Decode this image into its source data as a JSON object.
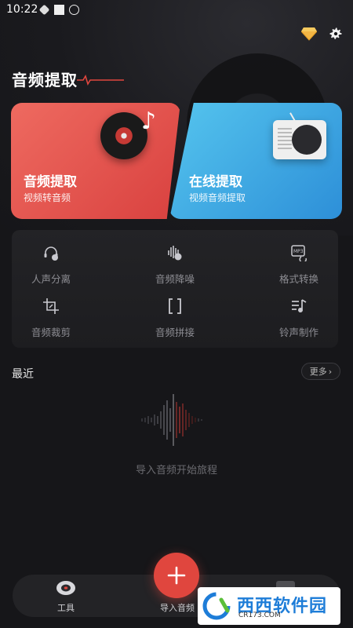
{
  "status_bar": {
    "time": "10:22"
  },
  "header": {
    "title": "音频提取"
  },
  "cards": [
    {
      "title": "音频提取",
      "subtitle": "视频转音频"
    },
    {
      "title": "在线提取",
      "subtitle": "视频音频提取"
    }
  ],
  "tools": [
    {
      "label": "人声分离",
      "icon": "vocal-separation-icon"
    },
    {
      "label": "音频降噪",
      "icon": "noise-reduction-icon"
    },
    {
      "label": "格式转换",
      "icon": "format-convert-icon"
    },
    {
      "label": "音频裁剪",
      "icon": "crop-icon"
    },
    {
      "label": "音频拼接",
      "icon": "join-icon"
    },
    {
      "label": "铃声制作",
      "icon": "ringtone-icon"
    }
  ],
  "recent": {
    "title": "最近",
    "more_label": "更多",
    "empty_text": "导入音频开始旅程"
  },
  "tabbar": {
    "tools_label": "工具",
    "import_label": "导入音频"
  },
  "watermark": {
    "brand": "西西软件园",
    "url": "CR173.COM"
  },
  "colors": {
    "accent_red": "#e0463e",
    "card_red": "#e85a52",
    "card_blue": "#3aa6e4",
    "background": "#161619"
  }
}
